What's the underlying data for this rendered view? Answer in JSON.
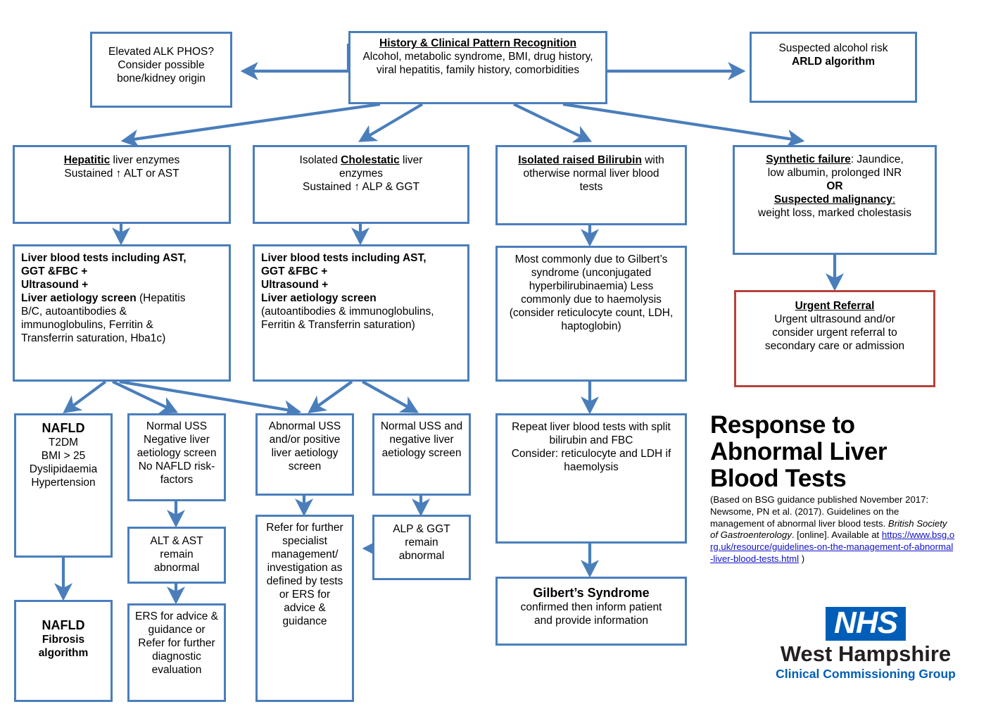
{
  "diagram": {
    "title_main": "Response to Abnormal Liver Blood Tests",
    "accent_blue": "#4a7ebb",
    "accent_red": "#b4433c",
    "nhs_blue": "#005eb8"
  },
  "boxes": {
    "alk_phos": {
      "line1": "Elevated ALK PHOS?",
      "line2": "Consider possible",
      "line3": "bone/kidney origin"
    },
    "history": {
      "heading": "History & Clinical Pattern Recognition",
      "body": "Alcohol, metabolic syndrome, BMI, drug history, viral hepatitis, family history, comorbidities"
    },
    "arld": {
      "line1": "Suspected alcohol risk",
      "line2": "ARLD  algorithm"
    },
    "hepatitic": {
      "heading": "Hepatitic",
      "heading_rest": " liver enzymes",
      "line2": "Sustained ↑ ALT or AST"
    },
    "cholestatic": {
      "prefix": "Isolated ",
      "heading": "Cholestatic",
      "heading_rest": " liver",
      "line2": "enzymes",
      "line3": "Sustained ↑ ALP & GGT"
    },
    "bilirubin": {
      "heading": "Isolated raised Bilirubin",
      "heading_rest": " with",
      "line2": "otherwise normal liver blood",
      "line3": "tests"
    },
    "synthetic": {
      "heading1": "Synthetic failure",
      "heading1_rest": ": Jaundice,",
      "line2": "low albumin, prolonged INR",
      "or_label": "OR",
      "heading2": "Suspected  malignancy",
      "heading2_rest": ":",
      "line4": "weight loss, marked cholestasis"
    },
    "lbt_hepatitic": {
      "l1": "Liver blood tests including AST,",
      "l2": "GGT &FBC +",
      "l3": "Ultrasound +",
      "l4_bold": "Liver aetiology screen",
      "l4_rest": " (Hepatitis",
      "l5": "B/C, autoantibodies &",
      "l6": "immunoglobulins,  Ferritin &",
      "l7": "Transferrin saturation, Hba1c)"
    },
    "lbt_cholestatic": {
      "l1": "Liver blood tests including AST,",
      "l2": "GGT &FBC +",
      "l3": "Ultrasound +",
      "l4_bold": "Liver aetiology screen",
      "l5": "(autoantibodies  & immunoglobulins,",
      "l6": "Ferritin & Transferrin saturation)"
    },
    "gilbert_cause": {
      "body": "Most commonly due to Gilbert’s syndrome (unconjugated hyperbilirubinaemia) Less commonly due to haemolysis (consider reticulocyte count, LDH, haptoglobin)"
    },
    "urgent_referral": {
      "heading": "Urgent Referral",
      "line2": "Urgent ultrasound and/or",
      "line3": "consider urgent referral to",
      "line4": "secondary care or admission"
    },
    "nafld": {
      "heading": "NAFLD",
      "l2": "T2DM",
      "l3": "BMI > 25",
      "l4": "Dyslipidaemia",
      "l5": "Hypertension"
    },
    "normal_uss_neg": {
      "body": "Normal USS Negative liver aetiology screen No NAFLD risk-factors"
    },
    "abnormal_uss": {
      "body": "Abnormal USS and/or positive liver aetiology screen"
    },
    "normal_uss_neg2": {
      "body": "Normal USS and negative liver aetiology screen"
    },
    "repeat_lbt": {
      "l1": "Repeat liver blood tests with split",
      "l2": "bilirubin and FBC",
      "l3": "Consider: reticulocyte and LDH if",
      "l4": "haemolysis"
    },
    "alt_ast_abnormal": {
      "l1": "ALT & AST",
      "l2": "remain",
      "l3": "abnormal"
    },
    "refer_specialist": {
      "body": "Refer for further specialist management/ investigation as defined by tests or ERS for advice & guidance"
    },
    "alp_ggt_abnormal": {
      "l1": "ALP & GGT",
      "l2": "remain",
      "l3": "abnormal"
    },
    "nafld_fibrosis": {
      "l1": "NAFLD",
      "l2": "Fibrosis",
      "l3": "algorithm"
    },
    "ers_advice": {
      "body": "ERS for advice & guidance or Refer for further diagnostic evaluation"
    },
    "gilbert_syndrome": {
      "heading": "Gilbert’s Syndrome",
      "l2": "confirmed then inform patient",
      "l3": "and provide information"
    }
  },
  "reference": {
    "l1": "(Based on BSG guidance published  November 2017:",
    "l2": "Newsome, PN et al. (2017).  Guidelines on the management of abnormal liver blood tests. ",
    "l2_italic": "British Society of Gastroenterology",
    "l2_end": ".  [online]. Available at",
    "link": "https://www.bsg.org.uk/resource/guidelines-on-the-management-of-abnormal-liver-blood-tests.html",
    "close_paren": ")"
  },
  "nhs": {
    "mark": "NHS",
    "line1": "West Hampshire",
    "line2": "Clinical Commissioning Group"
  }
}
